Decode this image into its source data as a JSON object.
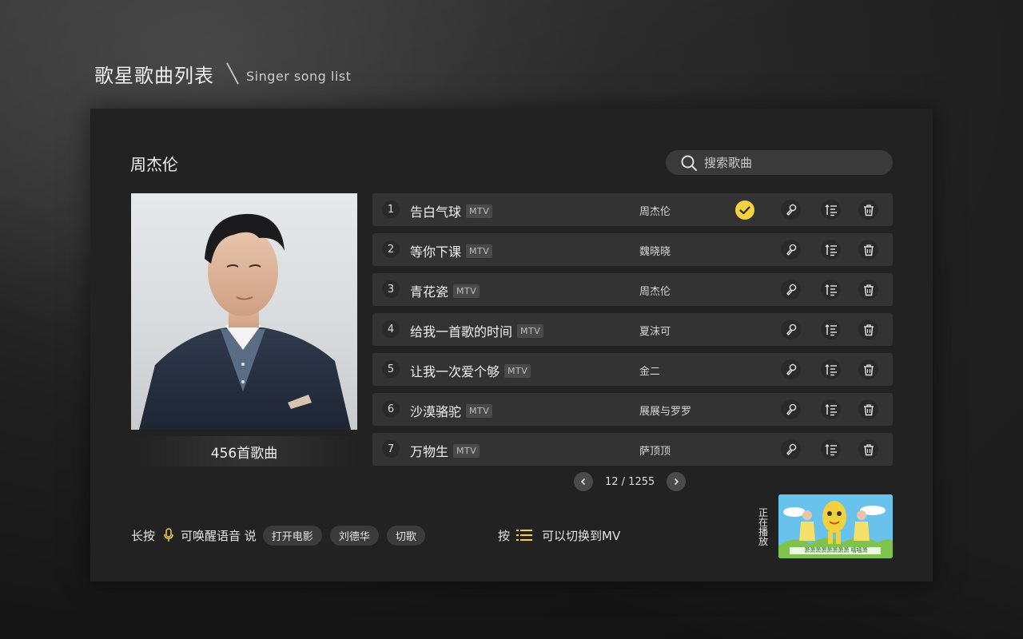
{
  "header": {
    "title_cn": "歌星歌曲列表",
    "title_en": "Singer song list"
  },
  "singer": {
    "name": "周杰伦",
    "song_count": "456首歌曲"
  },
  "search": {
    "placeholder": "搜索歌曲"
  },
  "songs": [
    {
      "index": "1",
      "title": "告白气球",
      "badge": "MTV",
      "artist": "周杰伦",
      "selected": true
    },
    {
      "index": "2",
      "title": "等你下课",
      "badge": "MTV",
      "artist": "魏晓晓",
      "selected": false
    },
    {
      "index": "3",
      "title": "青花瓷",
      "badge": "MTV",
      "artist": "周杰伦",
      "selected": false
    },
    {
      "index": "4",
      "title": "给我一首歌的时间",
      "badge": "MTV",
      "artist": "夏沫可",
      "selected": false
    },
    {
      "index": "5",
      "title": "让我一次爱个够",
      "badge": "MTV",
      "artist": "金二",
      "selected": false
    },
    {
      "index": "6",
      "title": "沙漠骆驼",
      "badge": "MTV",
      "artist": "展展与罗罗",
      "selected": false
    },
    {
      "index": "7",
      "title": "万物生",
      "badge": "MTV",
      "artist": "萨顶顶",
      "selected": false
    }
  ],
  "pager": {
    "text": "12 / 1255"
  },
  "voice_hint": {
    "prefix": "长按",
    "middle": "可唤醒语音 说",
    "chips": [
      "打开电影",
      "刘德华",
      "切歌"
    ]
  },
  "mv_hint": {
    "prefix": "按",
    "suffix": "可以切换到MV"
  },
  "now_playing": {
    "label": "正在播放",
    "caption": "萧萧萧萧萧萧萧萧 嘻嘻萧"
  },
  "colors": {
    "accent": "#f5d142",
    "panel": "#222222",
    "row": "#333333"
  }
}
